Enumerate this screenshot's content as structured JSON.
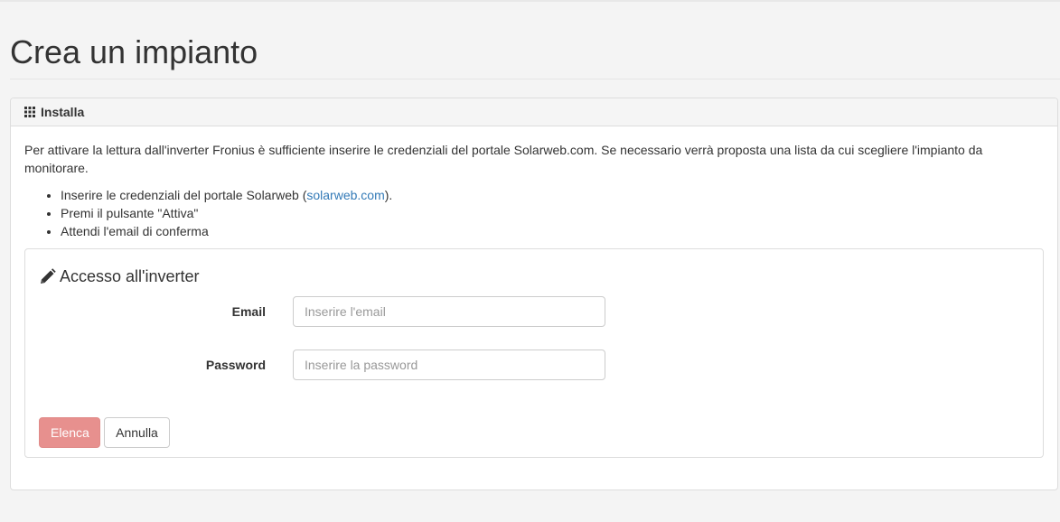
{
  "page": {
    "title": "Crea un impianto"
  },
  "panel": {
    "heading_icon": "th-grid-icon",
    "heading": "Installa",
    "intro": "Per attivare la lettura dall'inverter Fronius è sufficiente inserire le credenziali del portale Solarweb.com. Se necessario verrà proposta una lista da cui scegliere l'impianto da monitorare.",
    "steps": {
      "step1_prefix": "Inserire le credenziali del portale Solarweb (",
      "step1_link": "solarweb.com",
      "step1_suffix": ").",
      "step2": "Premi il pulsante \"Attiva\"",
      "step3": "Attendi l'email di conferma"
    }
  },
  "form": {
    "title_icon": "pencil-icon",
    "title": "Accesso all'inverter",
    "email": {
      "label": "Email",
      "placeholder": "Inserire l'email",
      "value": ""
    },
    "password": {
      "label": "Password",
      "placeholder": "Inserire la password",
      "value": ""
    },
    "buttons": {
      "submit_label": "Elenca",
      "cancel_label": "Annulla"
    }
  },
  "colors": {
    "primary_disabled": "#e7908e",
    "link": "#337ab7"
  }
}
